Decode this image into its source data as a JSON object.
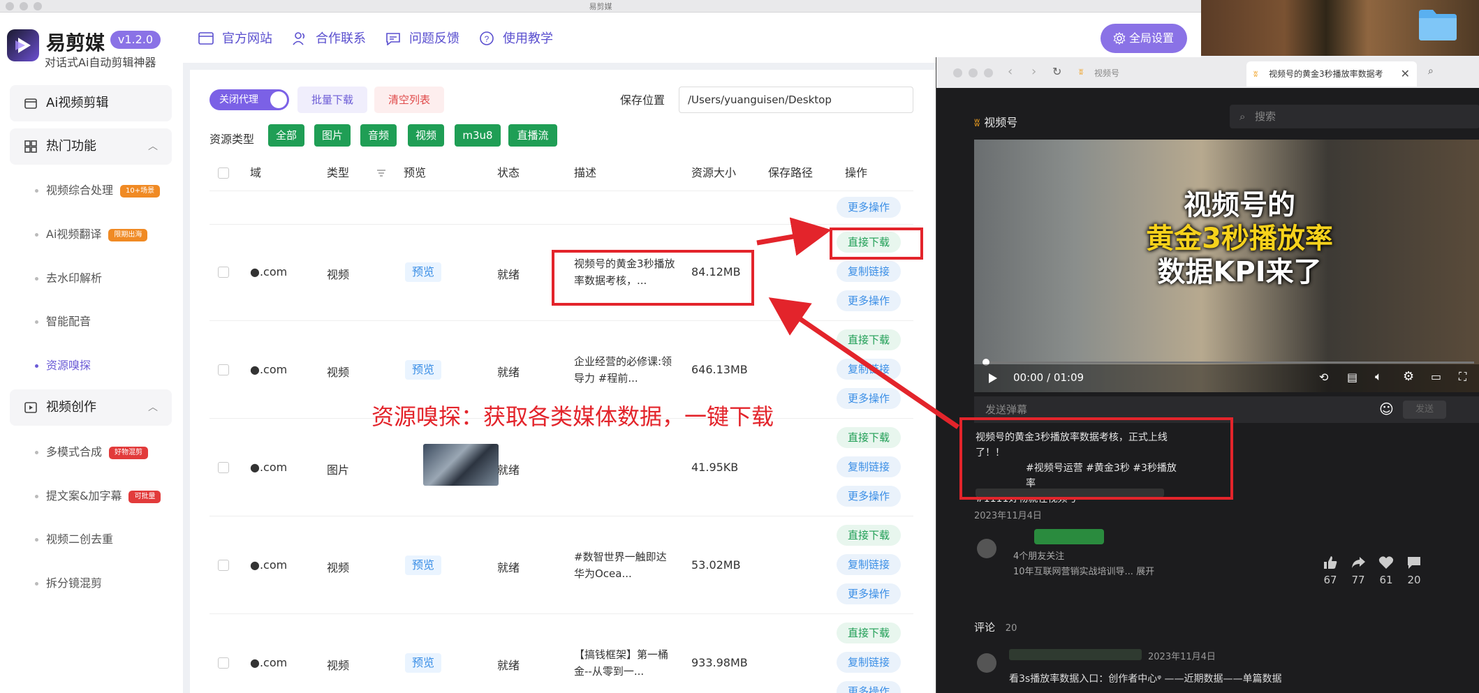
{
  "window": {
    "title": "易剪媒"
  },
  "sidebar": {
    "brand": "易剪媒",
    "version": "v1.2.0",
    "slogan": "对话式Ai自动剪辑神器",
    "sections": [
      {
        "label": "Ai视频剪辑"
      },
      {
        "label": "热门功能"
      },
      {
        "label": "视频创作"
      }
    ],
    "items": [
      {
        "label": "视频综合处理",
        "tag": "10+场景"
      },
      {
        "label": "Ai视频翻译",
        "tag": "限期出海"
      },
      {
        "label": "去水印解析"
      },
      {
        "label": "智能配音"
      },
      {
        "label": "资源嗅探"
      },
      {
        "label": "多模式合成",
        "tag": "好物混剪"
      },
      {
        "label": "提文案&加字幕",
        "tag": "可批量"
      },
      {
        "label": "视频二创去重"
      },
      {
        "label": "拆分镜混剪"
      }
    ]
  },
  "header": {
    "links": [
      "官方网站",
      "合作联系",
      "问题反馈",
      "使用教学"
    ],
    "global_settings": "全局设置"
  },
  "toolbar": {
    "proxy_toggle": "关闭代理",
    "batch_download": "批量下载",
    "clear_list": "清空列表",
    "save_location_label": "保存位置",
    "save_location_value": "/Users/yuanguisen/Desktop",
    "resource_type_label": "资源类型",
    "types": [
      "全部",
      "图片",
      "音频",
      "视频",
      "m3u8",
      "直播流"
    ]
  },
  "table": {
    "columns": [
      "域",
      "类型",
      "预览",
      "状态",
      "描述",
      "资源大小",
      "保存路径",
      "操作"
    ],
    "preview_label": "预览",
    "actions": {
      "direct": "直接下载",
      "copy": "复制链接",
      "more": "更多操作"
    },
    "rows": [
      {
        "domain": "●.com",
        "type": "视频",
        "status": "就绪",
        "desc": "视频号的黄金3秒播放率数据考核，...",
        "size": "84.12MB"
      },
      {
        "domain": "●.com",
        "type": "视频",
        "status": "就绪",
        "desc": "企业经营的必修课:领导力 #程前...",
        "size": "646.13MB"
      },
      {
        "domain": "●.com",
        "type": "图片",
        "status": "就绪",
        "desc": "",
        "size": "41.95KB"
      },
      {
        "domain": "●.com",
        "type": "视频",
        "status": "就绪",
        "desc": "#数智世界一触即达 华为Ocea...",
        "size": "53.02MB"
      },
      {
        "domain": "●.com",
        "type": "视频",
        "status": "就绪",
        "desc": "【搞钱框架】第一桶金--从零到一...",
        "size": "933.98MB"
      }
    ]
  },
  "browser": {
    "tab_title": "视频号的黄金3秒播放率数据考",
    "site_tab": "视频号",
    "logo": "视频号",
    "search_placeholder": "搜索",
    "video_caption_1": "视频号的",
    "video_caption_2": "黄金3秒播放率",
    "video_caption_3": "数据KPI来了",
    "time": "00:00 / 01:09",
    "danmu_placeholder": "发送弹幕",
    "danmu_send": "发送",
    "desc_1": "视频号的黄金3秒播放率数据考核，正式上线了！！",
    "desc_2": "#视频号运营 #黄金3秒 #3秒播放率",
    "desc_3": "#1111好物就在视频号",
    "date": "2023年11月4日",
    "follow": "4个朋友关注",
    "bio": "10年互联网营销实战培训导... 展开",
    "stats": [
      "67",
      "77",
      "61",
      "20"
    ],
    "comments_label": "评论",
    "comments_count": "20",
    "comment_date": "2023年11月4日",
    "comment_text": "看3s播放率数据入口：创作者中心ᵠ ——近期数据——单篇数据"
  },
  "annotation": {
    "text": "资源嗅探：获取各类媒体数据，一键下载"
  },
  "colors": {
    "accent": "#7b61e6",
    "green": "#1f9e55",
    "annotation": "#e3242b"
  }
}
